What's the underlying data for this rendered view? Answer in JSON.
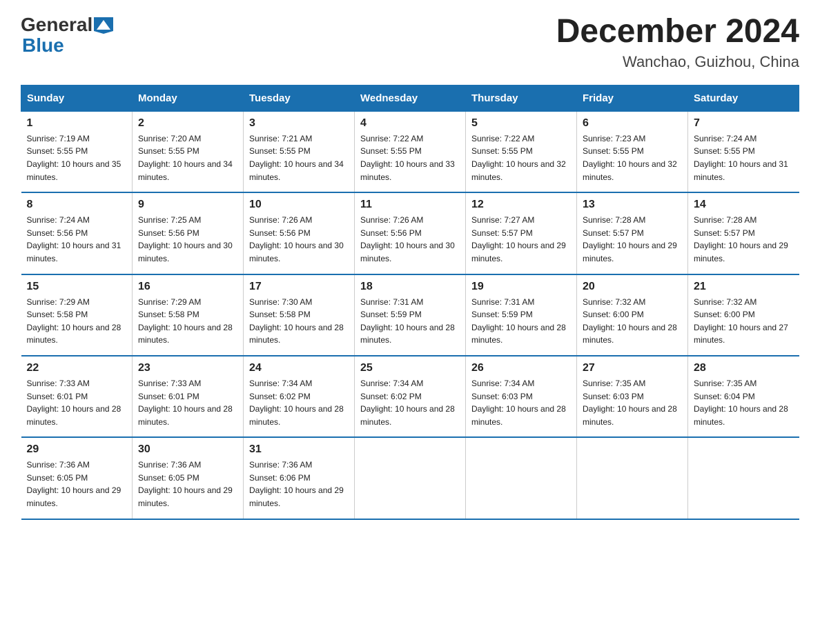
{
  "logo": {
    "general": "General",
    "blue": "Blue"
  },
  "title": {
    "month_year": "December 2024",
    "location": "Wanchao, Guizhou, China"
  },
  "headers": [
    "Sunday",
    "Monday",
    "Tuesday",
    "Wednesday",
    "Thursday",
    "Friday",
    "Saturday"
  ],
  "weeks": [
    [
      {
        "day": "1",
        "sunrise": "7:19 AM",
        "sunset": "5:55 PM",
        "daylight": "10 hours and 35 minutes."
      },
      {
        "day": "2",
        "sunrise": "7:20 AM",
        "sunset": "5:55 PM",
        "daylight": "10 hours and 34 minutes."
      },
      {
        "day": "3",
        "sunrise": "7:21 AM",
        "sunset": "5:55 PM",
        "daylight": "10 hours and 34 minutes."
      },
      {
        "day": "4",
        "sunrise": "7:22 AM",
        "sunset": "5:55 PM",
        "daylight": "10 hours and 33 minutes."
      },
      {
        "day": "5",
        "sunrise": "7:22 AM",
        "sunset": "5:55 PM",
        "daylight": "10 hours and 32 minutes."
      },
      {
        "day": "6",
        "sunrise": "7:23 AM",
        "sunset": "5:55 PM",
        "daylight": "10 hours and 32 minutes."
      },
      {
        "day": "7",
        "sunrise": "7:24 AM",
        "sunset": "5:55 PM",
        "daylight": "10 hours and 31 minutes."
      }
    ],
    [
      {
        "day": "8",
        "sunrise": "7:24 AM",
        "sunset": "5:56 PM",
        "daylight": "10 hours and 31 minutes."
      },
      {
        "day": "9",
        "sunrise": "7:25 AM",
        "sunset": "5:56 PM",
        "daylight": "10 hours and 30 minutes."
      },
      {
        "day": "10",
        "sunrise": "7:26 AM",
        "sunset": "5:56 PM",
        "daylight": "10 hours and 30 minutes."
      },
      {
        "day": "11",
        "sunrise": "7:26 AM",
        "sunset": "5:56 PM",
        "daylight": "10 hours and 30 minutes."
      },
      {
        "day": "12",
        "sunrise": "7:27 AM",
        "sunset": "5:57 PM",
        "daylight": "10 hours and 29 minutes."
      },
      {
        "day": "13",
        "sunrise": "7:28 AM",
        "sunset": "5:57 PM",
        "daylight": "10 hours and 29 minutes."
      },
      {
        "day": "14",
        "sunrise": "7:28 AM",
        "sunset": "5:57 PM",
        "daylight": "10 hours and 29 minutes."
      }
    ],
    [
      {
        "day": "15",
        "sunrise": "7:29 AM",
        "sunset": "5:58 PM",
        "daylight": "10 hours and 28 minutes."
      },
      {
        "day": "16",
        "sunrise": "7:29 AM",
        "sunset": "5:58 PM",
        "daylight": "10 hours and 28 minutes."
      },
      {
        "day": "17",
        "sunrise": "7:30 AM",
        "sunset": "5:58 PM",
        "daylight": "10 hours and 28 minutes."
      },
      {
        "day": "18",
        "sunrise": "7:31 AM",
        "sunset": "5:59 PM",
        "daylight": "10 hours and 28 minutes."
      },
      {
        "day": "19",
        "sunrise": "7:31 AM",
        "sunset": "5:59 PM",
        "daylight": "10 hours and 28 minutes."
      },
      {
        "day": "20",
        "sunrise": "7:32 AM",
        "sunset": "6:00 PM",
        "daylight": "10 hours and 28 minutes."
      },
      {
        "day": "21",
        "sunrise": "7:32 AM",
        "sunset": "6:00 PM",
        "daylight": "10 hours and 27 minutes."
      }
    ],
    [
      {
        "day": "22",
        "sunrise": "7:33 AM",
        "sunset": "6:01 PM",
        "daylight": "10 hours and 28 minutes."
      },
      {
        "day": "23",
        "sunrise": "7:33 AM",
        "sunset": "6:01 PM",
        "daylight": "10 hours and 28 minutes."
      },
      {
        "day": "24",
        "sunrise": "7:34 AM",
        "sunset": "6:02 PM",
        "daylight": "10 hours and 28 minutes."
      },
      {
        "day": "25",
        "sunrise": "7:34 AM",
        "sunset": "6:02 PM",
        "daylight": "10 hours and 28 minutes."
      },
      {
        "day": "26",
        "sunrise": "7:34 AM",
        "sunset": "6:03 PM",
        "daylight": "10 hours and 28 minutes."
      },
      {
        "day": "27",
        "sunrise": "7:35 AM",
        "sunset": "6:03 PM",
        "daylight": "10 hours and 28 minutes."
      },
      {
        "day": "28",
        "sunrise": "7:35 AM",
        "sunset": "6:04 PM",
        "daylight": "10 hours and 28 minutes."
      }
    ],
    [
      {
        "day": "29",
        "sunrise": "7:36 AM",
        "sunset": "6:05 PM",
        "daylight": "10 hours and 29 minutes."
      },
      {
        "day": "30",
        "sunrise": "7:36 AM",
        "sunset": "6:05 PM",
        "daylight": "10 hours and 29 minutes."
      },
      {
        "day": "31",
        "sunrise": "7:36 AM",
        "sunset": "6:06 PM",
        "daylight": "10 hours and 29 minutes."
      },
      {
        "day": "",
        "sunrise": "",
        "sunset": "",
        "daylight": ""
      },
      {
        "day": "",
        "sunrise": "",
        "sunset": "",
        "daylight": ""
      },
      {
        "day": "",
        "sunrise": "",
        "sunset": "",
        "daylight": ""
      },
      {
        "day": "",
        "sunrise": "",
        "sunset": "",
        "daylight": ""
      }
    ]
  ],
  "labels": {
    "sunrise_prefix": "Sunrise: ",
    "sunset_prefix": "Sunset: ",
    "daylight_prefix": "Daylight: "
  }
}
